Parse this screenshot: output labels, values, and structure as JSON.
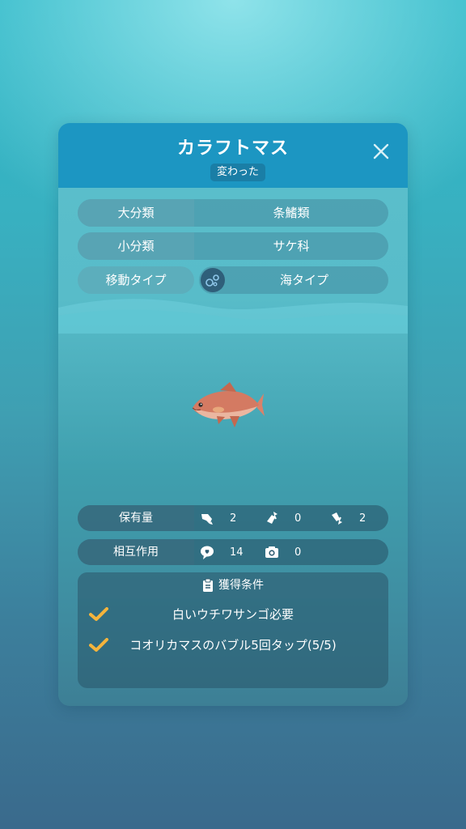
{
  "header": {
    "title": "カラフトマス",
    "badge": "変わった"
  },
  "info": {
    "major_label": "大分類",
    "major_value": "条鰭類",
    "minor_label": "小分類",
    "minor_value": "サケ科",
    "move_label": "移動タイプ",
    "move_value": "海タイプ"
  },
  "holdings": {
    "label": "保有量",
    "items": [
      {
        "icon": "fish-icon",
        "value": "2"
      },
      {
        "icon": "fish-up-icon",
        "value": "0"
      },
      {
        "icon": "fish-down-icon",
        "value": "2"
      }
    ]
  },
  "interaction": {
    "label": "相互作用",
    "items": [
      {
        "icon": "speech-bubble-icon",
        "value": "14"
      },
      {
        "icon": "camera-icon",
        "value": "0"
      }
    ]
  },
  "conditions": {
    "title": "獲得条件",
    "items": [
      {
        "text": "白いウチワサンゴ必要",
        "done": true
      },
      {
        "text": "コオリカマスのバブル5回タップ(5/5)",
        "done": true
      }
    ]
  },
  "colors": {
    "header": "#1c96c2",
    "check": "#f5b43c"
  }
}
